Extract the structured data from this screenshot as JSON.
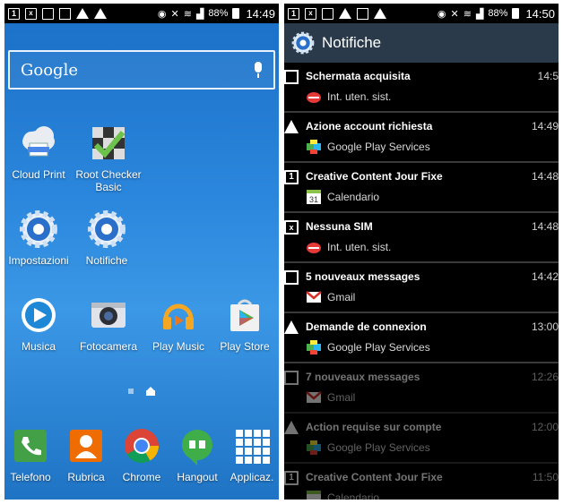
{
  "left": {
    "status": {
      "battery": "88%",
      "time": "14:49"
    },
    "search": {
      "label": "Google"
    },
    "apps": [
      {
        "label": "Cloud Print",
        "icon": "cloud-print-icon"
      },
      {
        "label": "Root Checker Basic",
        "icon": "root-checker-icon"
      },
      {
        "label": "Impostazioni",
        "icon": "settings-gear-icon"
      },
      {
        "label": "Notifiche",
        "icon": "notifications-gear-icon"
      },
      {
        "label": "Musica",
        "icon": "music-icon"
      },
      {
        "label": "Fotocamera",
        "icon": "camera-icon"
      },
      {
        "label": "Play Music",
        "icon": "headphones-icon"
      },
      {
        "label": "Play Store",
        "icon": "play-store-icon"
      }
    ],
    "dock": [
      {
        "label": "Telefono",
        "icon": "phone-icon"
      },
      {
        "label": "Rubrica",
        "icon": "contacts-icon"
      },
      {
        "label": "Chrome",
        "icon": "chrome-icon"
      },
      {
        "label": "Hangout",
        "icon": "hangouts-icon"
      },
      {
        "label": "Applicaz.",
        "icon": "apps-grid-icon"
      }
    ]
  },
  "right": {
    "status": {
      "battery": "88%",
      "time": "14:50"
    },
    "header": {
      "title": "Notifiche"
    },
    "notifications": [
      {
        "title": "Schermata acquisita",
        "time": "14:5",
        "app": "Int. uten. sist.",
        "icon": "screenshot-icon",
        "app_icon": "android-logo-icon",
        "dim": false
      },
      {
        "title": "Azione account richiesta",
        "time": "14:49",
        "app": "Google Play Services",
        "icon": "warning-icon",
        "app_icon": "puzzle-icon",
        "dim": false
      },
      {
        "title": "Creative Content Jour Fixe",
        "time": "14:48",
        "app": "Calendario",
        "icon": "calendar-one-icon",
        "app_icon": "calendar-icon",
        "dim": false
      },
      {
        "title": "Nessuna SIM",
        "time": "14:48",
        "app": "Int. uten. sist.",
        "icon": "no-sim-icon",
        "app_icon": "android-logo-icon",
        "dim": false
      },
      {
        "title": "5 nouveaux messages",
        "time": "14:42",
        "app": "Gmail",
        "icon": "mail-icon",
        "app_icon": "gmail-icon",
        "dim": false
      },
      {
        "title": "Demande de connexion",
        "time": "13:00",
        "app": "Google Play Services",
        "icon": "warning-icon",
        "app_icon": "puzzle-icon",
        "dim": false
      },
      {
        "title": "7 nouveaux messages",
        "time": "12:26",
        "app": "Gmail",
        "icon": "mail-icon",
        "app_icon": "gmail-icon",
        "dim": true
      },
      {
        "title": "Action requise sur compte",
        "time": "12:00",
        "app": "Google Play Services",
        "icon": "warning-icon",
        "app_icon": "puzzle-icon",
        "dim": true
      },
      {
        "title": "Creative Content Jour Fixe",
        "time": "11:50",
        "app": "Calendario",
        "icon": "calendar-one-icon",
        "app_icon": "calendar-icon",
        "dim": true
      }
    ]
  },
  "colors": {
    "home_bg_top": "#1b6fc6",
    "header_bg": "#2b3a4a",
    "notif_bg": "#000000"
  }
}
